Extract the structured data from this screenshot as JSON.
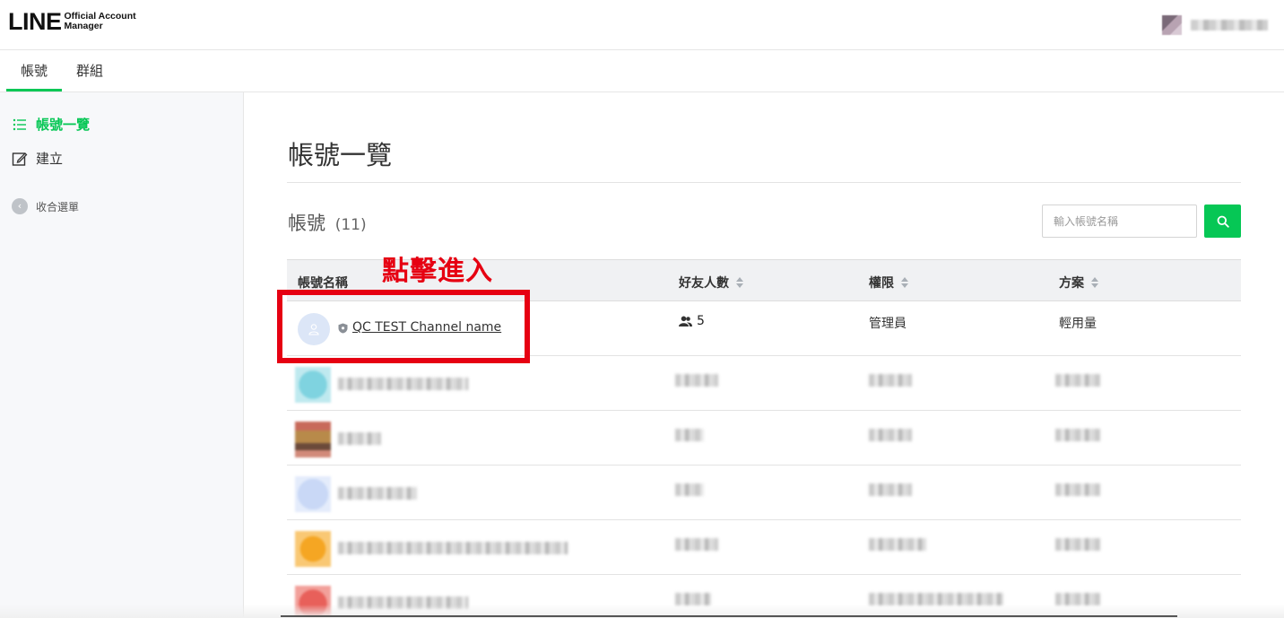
{
  "header": {
    "logo_main": "LINE",
    "logo_sub_line1": "Official Account",
    "logo_sub_line2": "Manager"
  },
  "tabs": [
    {
      "label": "帳號",
      "active": true
    },
    {
      "label": "群組",
      "active": false
    }
  ],
  "sidebar": {
    "items": [
      {
        "label": "帳號一覽",
        "icon": "list-icon",
        "active": true
      },
      {
        "label": "建立",
        "icon": "edit-icon",
        "active": false
      }
    ],
    "collapse_label": "收合選單",
    "collapse_icon": "‹"
  },
  "main": {
    "page_title": "帳號一覽",
    "section_title": "帳號",
    "section_count": "(11)",
    "search_placeholder": "輸入帳號名稱",
    "annotation": "點擊進入"
  },
  "table": {
    "columns": [
      "帳號名稱",
      "好友人數",
      "權限",
      "方案"
    ],
    "rows": [
      {
        "name": "QC TEST Channel name",
        "friends": "5",
        "role": "管理員",
        "plan": "輕用量"
      }
    ]
  },
  "colors": {
    "brand_green": "#06c755",
    "annotation_red": "#e60012"
  }
}
